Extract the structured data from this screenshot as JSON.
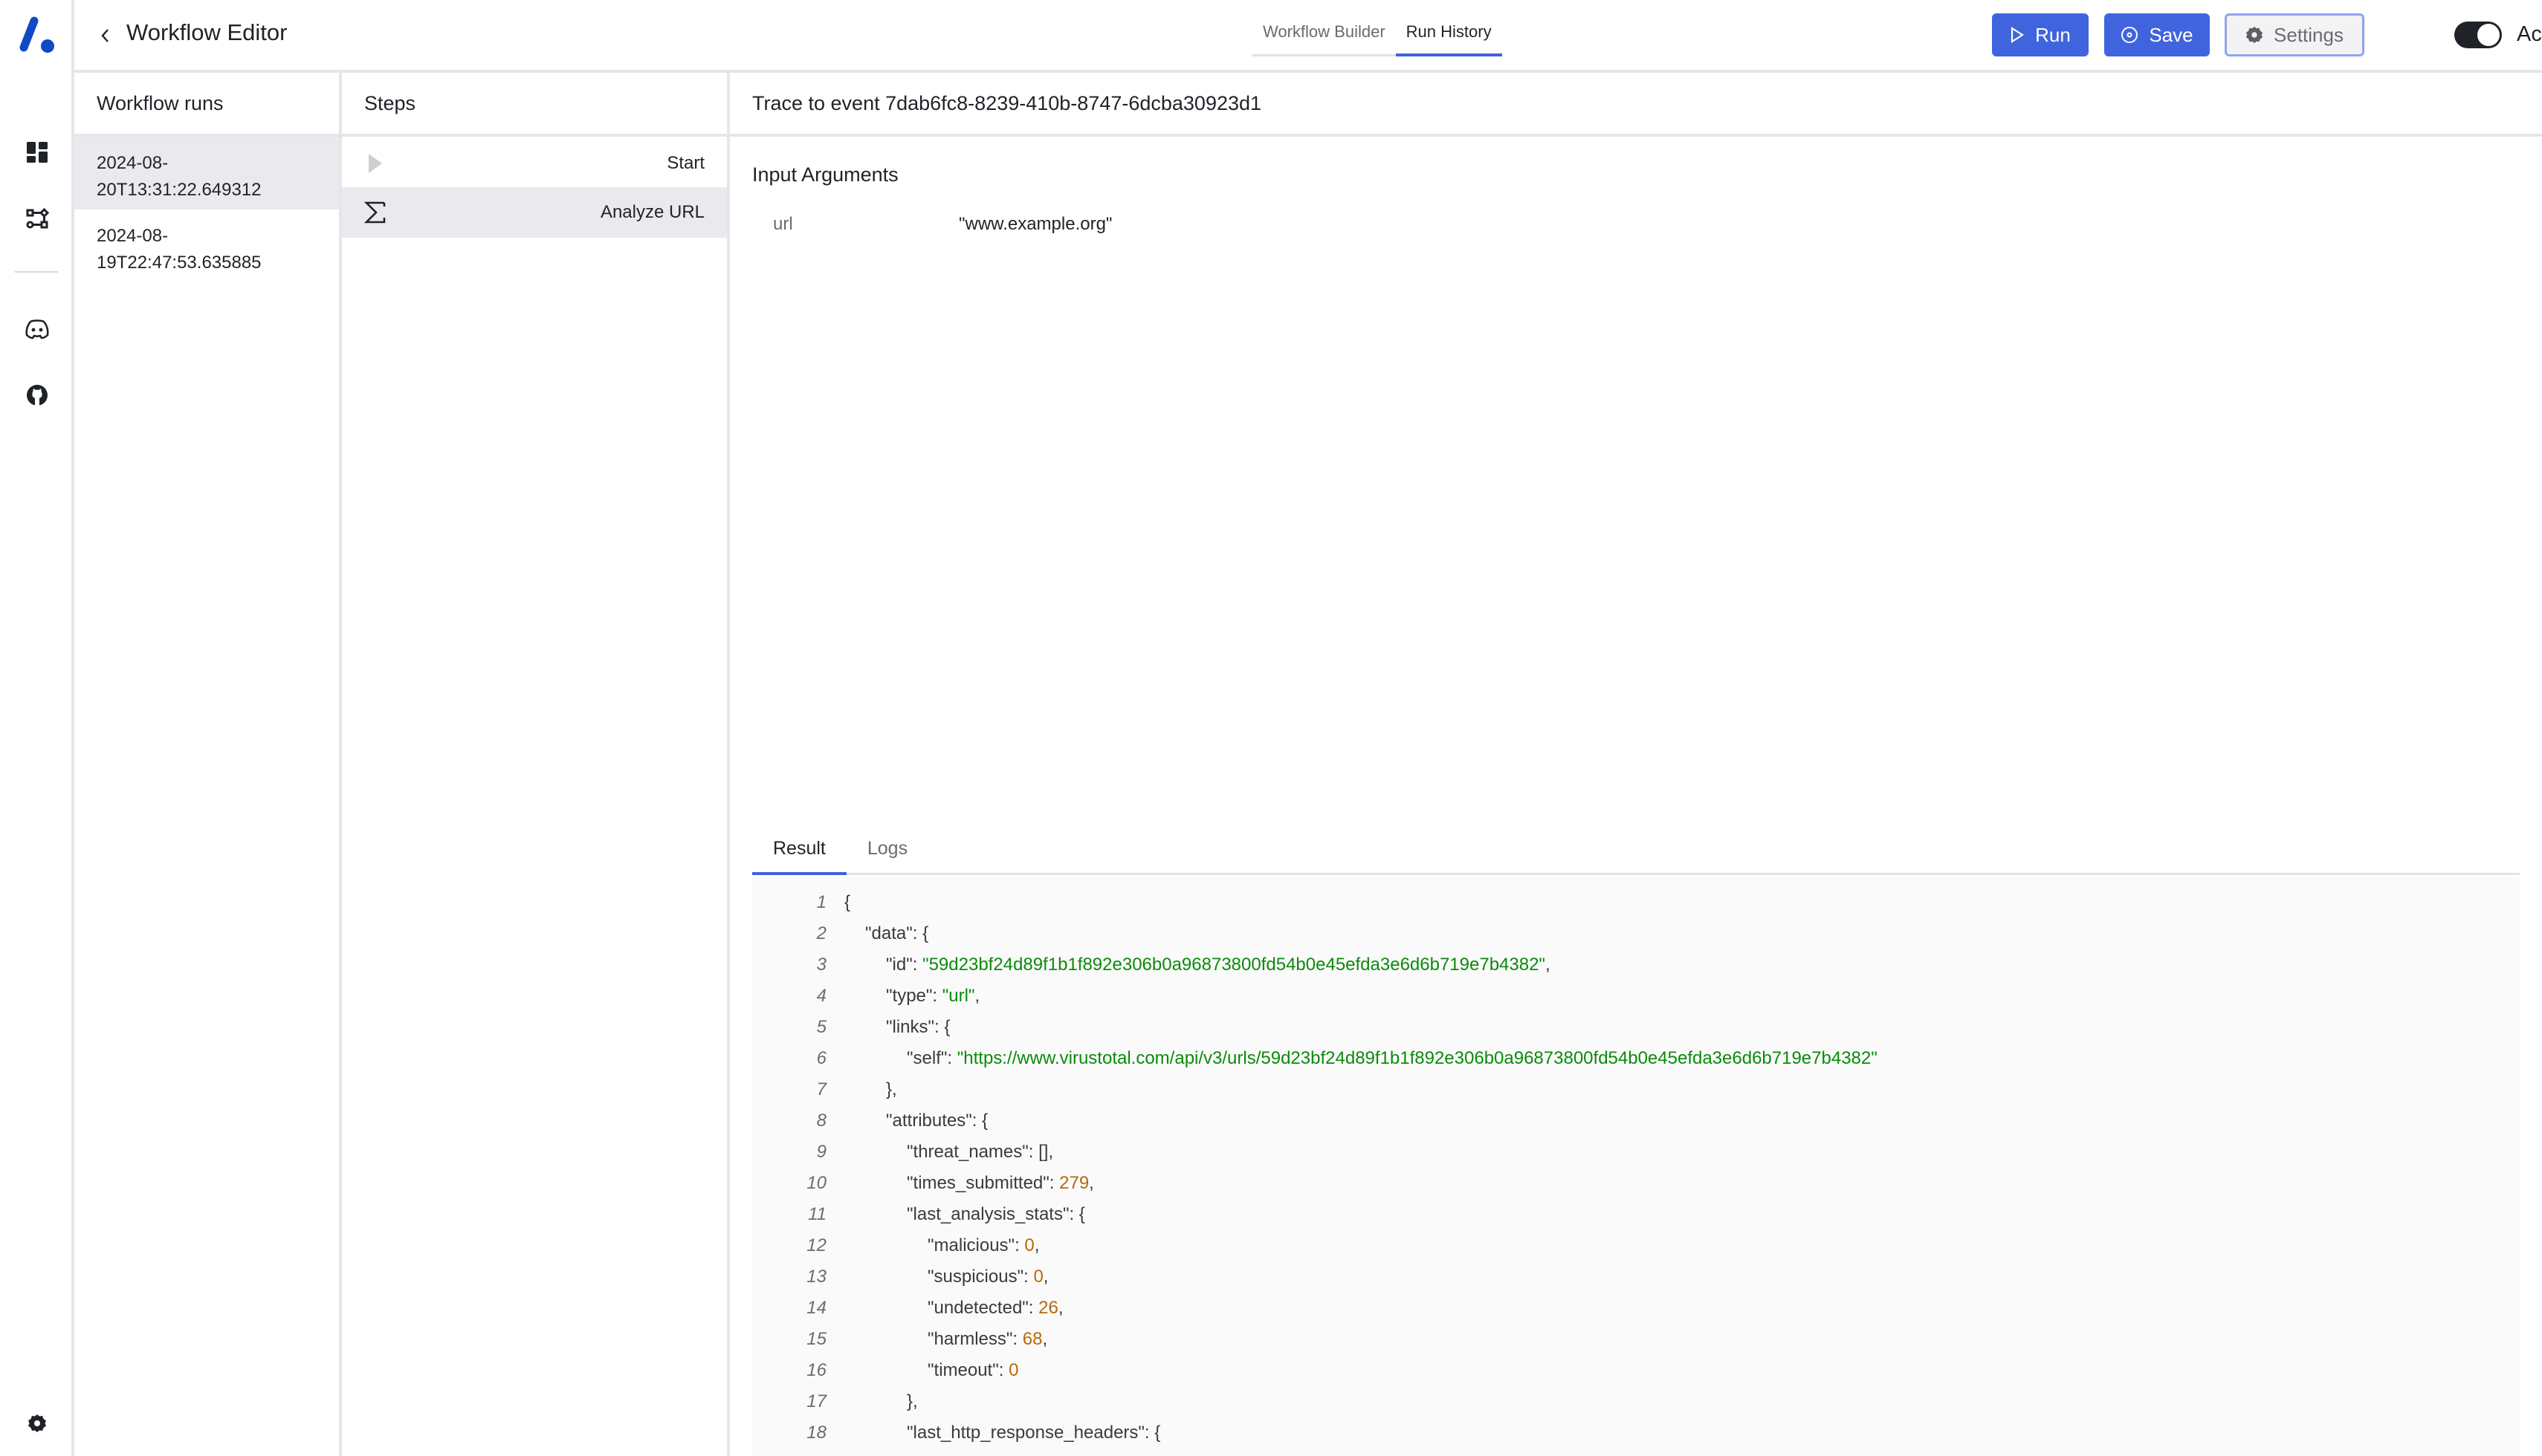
{
  "app": {
    "title": "Workflow Editor",
    "logo": "logo-icon",
    "colors": {
      "accent": "#4064dd",
      "string": "#0c8a0c",
      "number": "#b8690c",
      "selected_bg": "#eaeaee"
    }
  },
  "sidebar": {
    "items": [
      {
        "icon": "dashboard-icon"
      },
      {
        "icon": "workflow-icon"
      },
      {
        "icon": "discord-icon"
      },
      {
        "icon": "github-icon"
      }
    ],
    "footer_icon": "settings-icon"
  },
  "header": {
    "back_icon": "chevron-left-icon",
    "title": "Workflow Editor",
    "tabs": [
      {
        "label": "Workflow Builder",
        "active": false
      },
      {
        "label": "Run History",
        "active": true
      }
    ],
    "buttons": {
      "run": "Run",
      "save": "Save",
      "settings": "Settings"
    },
    "toggle": {
      "label": "Active",
      "on": true
    }
  },
  "runs": {
    "title": "Workflow runs",
    "items": [
      {
        "line1": "2024-08-",
        "line2": "20T13:31:22.649312",
        "selected": true
      },
      {
        "line1": "2024-08-",
        "line2": "19T22:47:53.635885",
        "selected": false
      }
    ]
  },
  "steps": {
    "title": "Steps",
    "items": [
      {
        "label": "Start",
        "icon": "play-icon",
        "selected": false
      },
      {
        "label": "Analyze URL",
        "icon": "sigma-icon",
        "selected": true
      }
    ]
  },
  "trace": {
    "title": "Trace to event 7dab6fc8-8239-410b-8747-6dcba30923d1",
    "input_title": "Input Arguments",
    "args": [
      {
        "key": "url",
        "value": "\"www.example.org\""
      }
    ],
    "tabs": [
      {
        "label": "Result",
        "active": true
      },
      {
        "label": "Logs",
        "active": false
      }
    ],
    "code_lines": [
      {
        "n": "1",
        "indent": 0,
        "parts": [
          {
            "t": "{",
            "c": "p"
          }
        ]
      },
      {
        "n": "2",
        "indent": 1,
        "parts": [
          {
            "t": "\"data\": {",
            "c": "p"
          }
        ]
      },
      {
        "n": "3",
        "indent": 2,
        "parts": [
          {
            "t": "\"id\": ",
            "c": "p"
          },
          {
            "t": "\"59d23bf24d89f1b1f892e306b0a96873800fd54b0e45efda3e6d6b719e7b4382\"",
            "c": "s"
          },
          {
            "t": ",",
            "c": "p"
          }
        ]
      },
      {
        "n": "4",
        "indent": 2,
        "parts": [
          {
            "t": "\"type\": ",
            "c": "p"
          },
          {
            "t": "\"url\"",
            "c": "s"
          },
          {
            "t": ",",
            "c": "p"
          }
        ]
      },
      {
        "n": "5",
        "indent": 2,
        "parts": [
          {
            "t": "\"links\": {",
            "c": "p"
          }
        ]
      },
      {
        "n": "6",
        "indent": 3,
        "parts": [
          {
            "t": "\"self\": ",
            "c": "p"
          },
          {
            "t": "\"https://www.virustotal.com/api/v3/urls/59d23bf24d89f1b1f892e306b0a96873800fd54b0e45efda3e6d6b719e7b4382\"",
            "c": "s"
          }
        ]
      },
      {
        "n": "7",
        "indent": 2,
        "parts": [
          {
            "t": "},",
            "c": "p"
          }
        ]
      },
      {
        "n": "8",
        "indent": 2,
        "parts": [
          {
            "t": "\"attributes\": {",
            "c": "p"
          }
        ]
      },
      {
        "n": "9",
        "indent": 3,
        "parts": [
          {
            "t": "\"threat_names\": [],",
            "c": "p"
          }
        ]
      },
      {
        "n": "10",
        "indent": 3,
        "parts": [
          {
            "t": "\"times_submitted\": ",
            "c": "p"
          },
          {
            "t": "279",
            "c": "n"
          },
          {
            "t": ",",
            "c": "p"
          }
        ]
      },
      {
        "n": "11",
        "indent": 3,
        "parts": [
          {
            "t": "\"last_analysis_stats\": {",
            "c": "p"
          }
        ]
      },
      {
        "n": "12",
        "indent": 4,
        "parts": [
          {
            "t": "\"malicious\": ",
            "c": "p"
          },
          {
            "t": "0",
            "c": "n"
          },
          {
            "t": ",",
            "c": "p"
          }
        ]
      },
      {
        "n": "13",
        "indent": 4,
        "parts": [
          {
            "t": "\"suspicious\": ",
            "c": "p"
          },
          {
            "t": "0",
            "c": "n"
          },
          {
            "t": ",",
            "c": "p"
          }
        ]
      },
      {
        "n": "14",
        "indent": 4,
        "parts": [
          {
            "t": "\"undetected\": ",
            "c": "p"
          },
          {
            "t": "26",
            "c": "n"
          },
          {
            "t": ",",
            "c": "p"
          }
        ]
      },
      {
        "n": "15",
        "indent": 4,
        "parts": [
          {
            "t": "\"harmless\": ",
            "c": "p"
          },
          {
            "t": "68",
            "c": "n"
          },
          {
            "t": ",",
            "c": "p"
          }
        ]
      },
      {
        "n": "16",
        "indent": 4,
        "parts": [
          {
            "t": "\"timeout\": ",
            "c": "p"
          },
          {
            "t": "0",
            "c": "n"
          }
        ]
      },
      {
        "n": "17",
        "indent": 3,
        "parts": [
          {
            "t": "},",
            "c": "p"
          }
        ]
      },
      {
        "n": "18",
        "indent": 3,
        "parts": [
          {
            "t": "\"last_http_response_headers\": {",
            "c": "p"
          }
        ]
      }
    ]
  }
}
